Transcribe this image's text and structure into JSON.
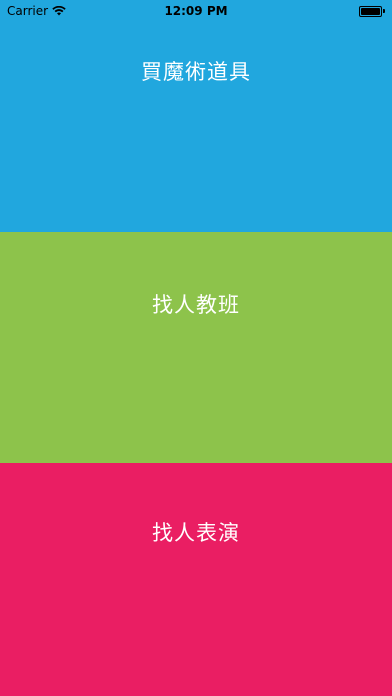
{
  "status_bar": {
    "carrier": "Carrier",
    "time": "12:09 PM",
    "battery_level": 1.0
  },
  "menu": {
    "items": [
      {
        "label": "買魔術道具",
        "color": "#21A7DE"
      },
      {
        "label": "找人教班",
        "color": "#8DC34B"
      },
      {
        "label": "找人表演",
        "color": "#EA1E63"
      }
    ]
  }
}
